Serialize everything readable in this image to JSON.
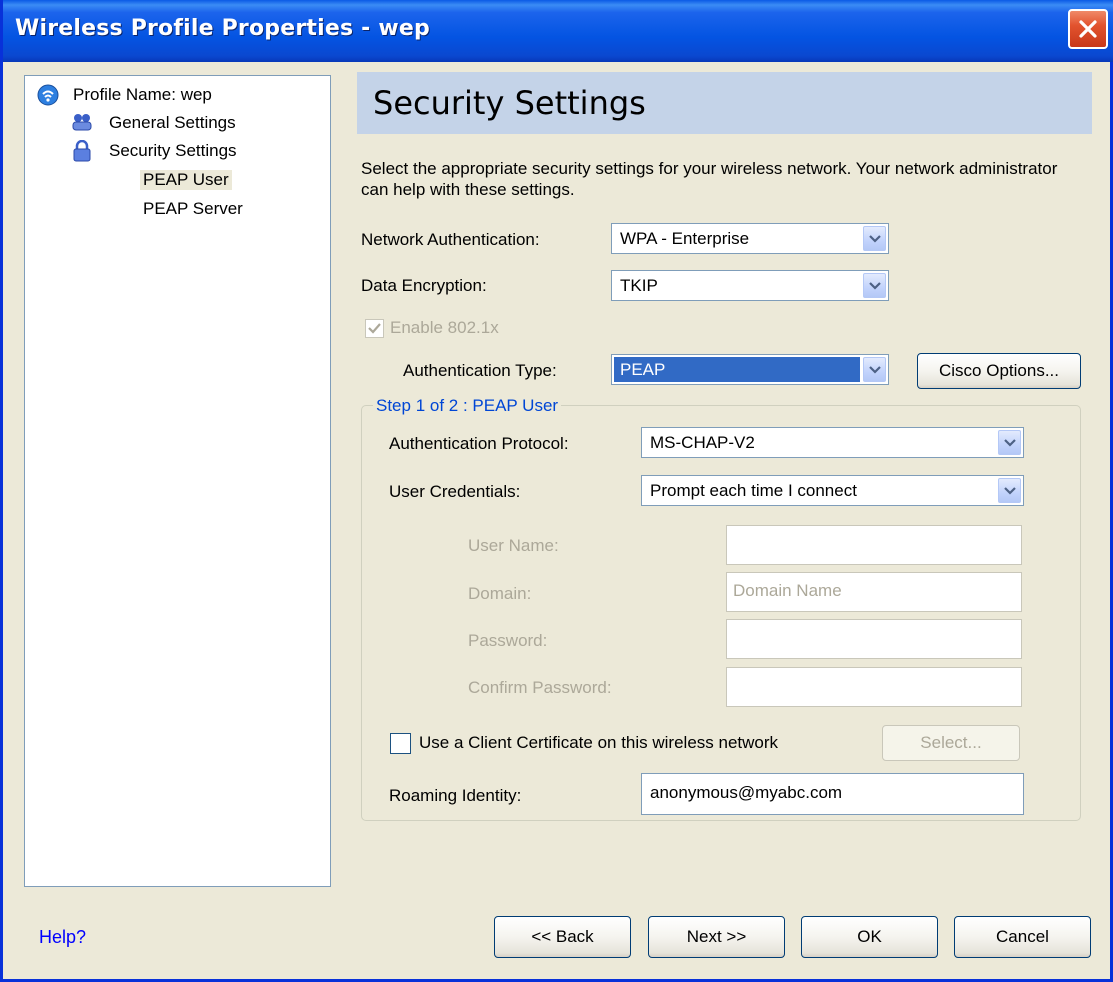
{
  "window": {
    "title": "Wireless Profile Properties - wep"
  },
  "tree": {
    "profile": "Profile Name: wep",
    "general": "General Settings",
    "security": "Security Settings",
    "peap_user": "PEAP User",
    "peap_server": "PEAP Server"
  },
  "header": {
    "title": "Security Settings"
  },
  "description": "Select the appropriate security settings for your wireless network. Your network administrator can help with these settings.",
  "network_auth": {
    "label": "Network Authentication:",
    "value": "WPA - Enterprise"
  },
  "data_encryption": {
    "label": "Data Encryption:",
    "value": "TKIP"
  },
  "enable_8021x": {
    "label": "Enable 802.1x",
    "checked": true,
    "disabled": true
  },
  "auth_type": {
    "label": "Authentication Type:",
    "value": "PEAP"
  },
  "cisco_options": {
    "label": "Cisco Options..."
  },
  "group": {
    "title": "Step 1 of 2 : PEAP User",
    "auth_protocol": {
      "label": "Authentication Protocol:",
      "value": "MS-CHAP-V2"
    },
    "user_credentials": {
      "label": "User Credentials:",
      "value": "Prompt each time I connect"
    },
    "user_name": {
      "label": "User Name:",
      "value": ""
    },
    "domain": {
      "label": "Domain:",
      "placeholder": "Domain Name"
    },
    "password": {
      "label": "Password:",
      "value": ""
    },
    "confirm_password": {
      "label": "Confirm Password:",
      "value": ""
    },
    "client_cert": {
      "label": "Use a Client Certificate on this wireless network",
      "checked": false
    },
    "select_button": "Select...",
    "roaming_identity": {
      "label": "Roaming Identity:",
      "value": "anonymous@myabc.com"
    }
  },
  "footer": {
    "help": "Help?",
    "back": "<< Back",
    "next": "Next >>",
    "ok": "OK",
    "cancel": "Cancel"
  },
  "colors": {
    "titlebar": "#0454e2",
    "header_band": "#c4d3e8",
    "selection": "#316ac5",
    "group_title": "#0046d5",
    "close": "#e2532e"
  }
}
